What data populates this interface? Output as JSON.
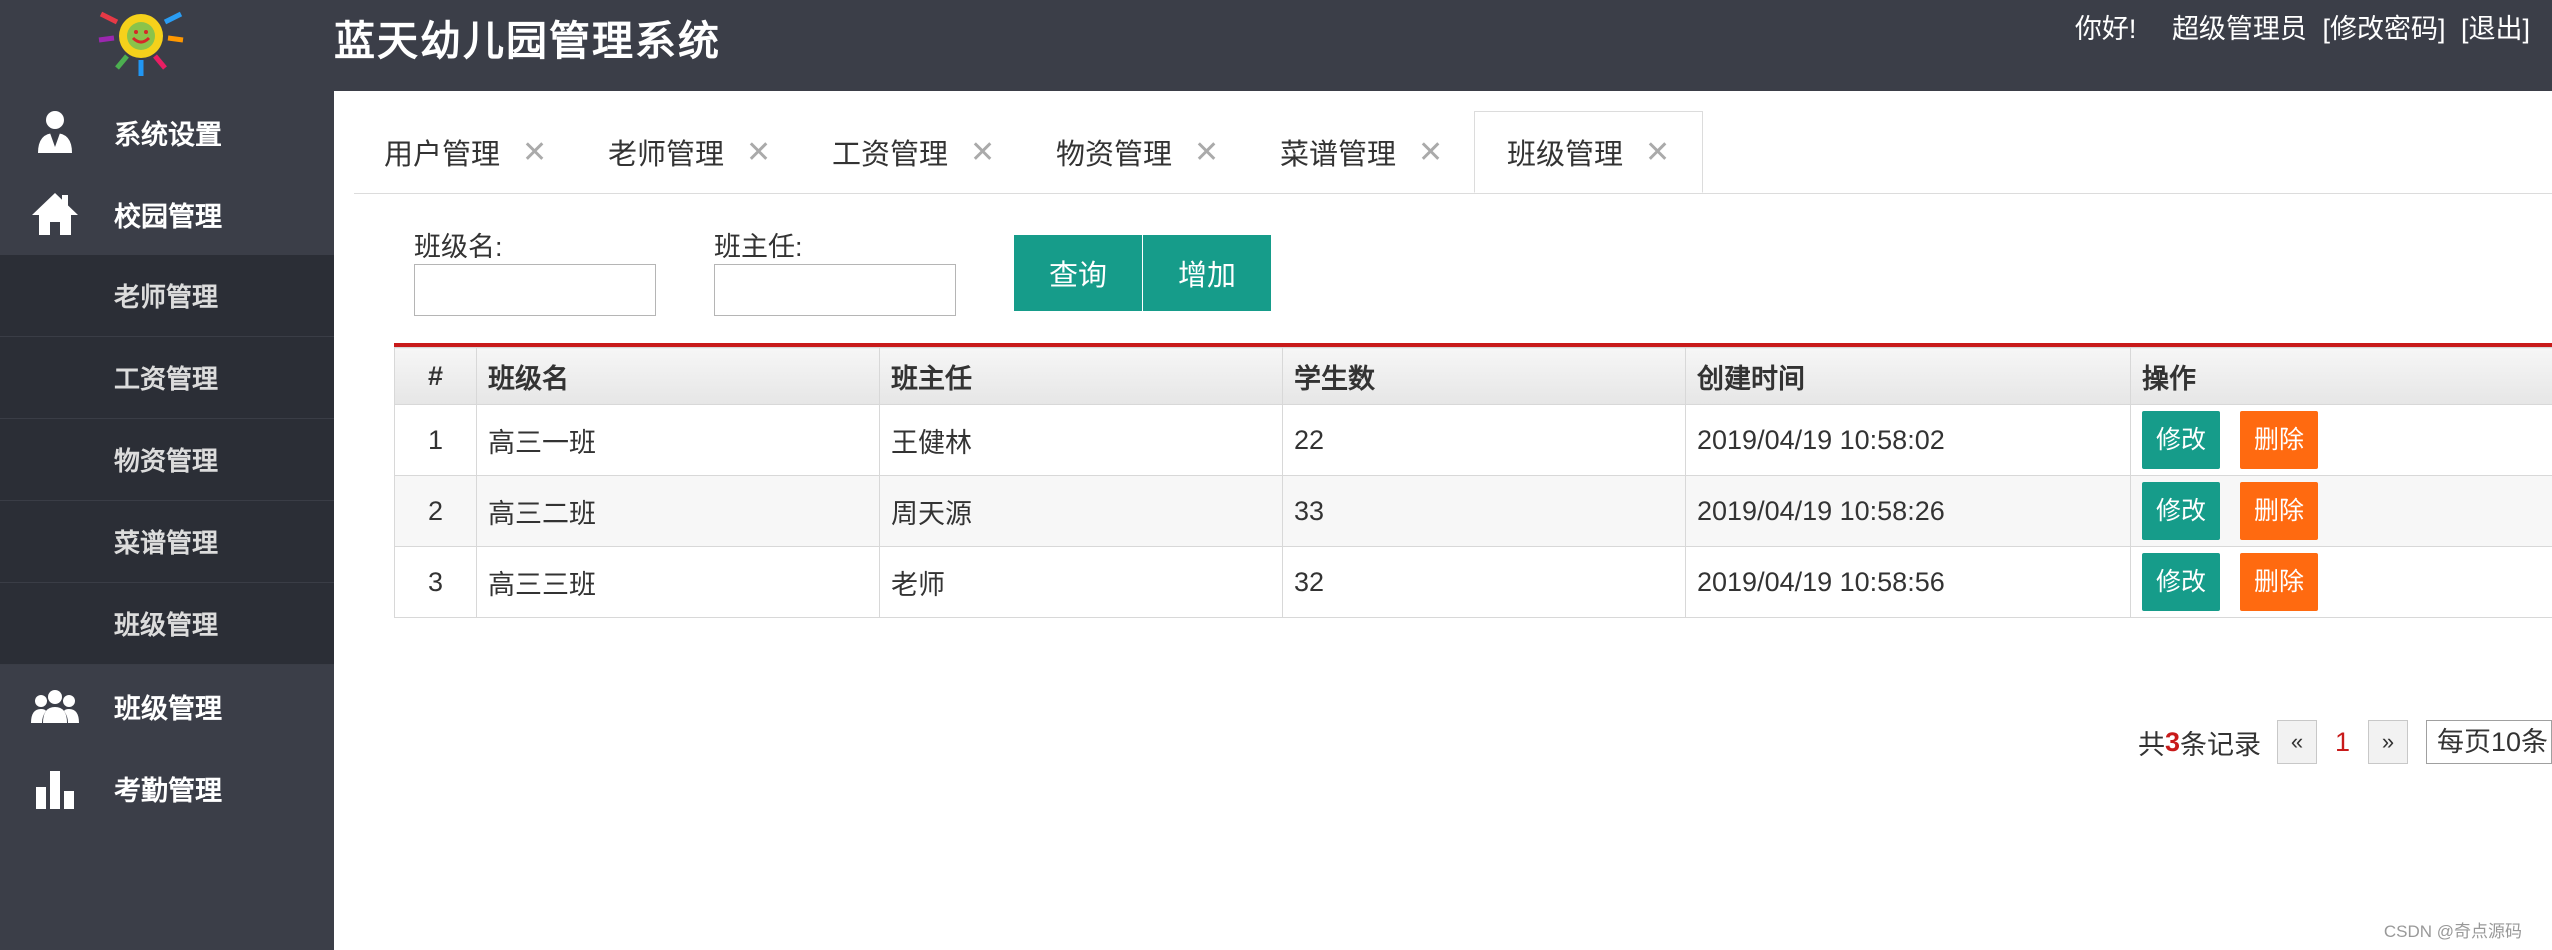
{
  "header": {
    "app_title": "蓝天幼儿园管理系统",
    "greeting": "你好!",
    "user_role": "超级管理员",
    "change_password": "[修改密码]",
    "logout": "[退出]"
  },
  "sidebar": {
    "items": [
      {
        "label": "系统设置",
        "icon": "user-settings-icon"
      },
      {
        "label": "校园管理",
        "icon": "home-icon"
      }
    ],
    "subitems": [
      {
        "label": "老师管理"
      },
      {
        "label": "工资管理"
      },
      {
        "label": "物资管理"
      },
      {
        "label": "菜谱管理"
      },
      {
        "label": "班级管理"
      }
    ],
    "items_after": [
      {
        "label": "班级管理",
        "icon": "group-icon"
      },
      {
        "label": "考勤管理",
        "icon": "bar-chart-icon"
      }
    ]
  },
  "tabs": [
    {
      "label": "用户管理",
      "active": false
    },
    {
      "label": "老师管理",
      "active": false
    },
    {
      "label": "工资管理",
      "active": false
    },
    {
      "label": "物资管理",
      "active": false
    },
    {
      "label": "菜谱管理",
      "active": false
    },
    {
      "label": "班级管理",
      "active": true
    }
  ],
  "search": {
    "class_name_label": "班级名:",
    "class_name_value": "",
    "teacher_label": "班主任:",
    "teacher_value": "",
    "query_button": "查询",
    "add_button": "增加"
  },
  "table": {
    "columns": [
      "#",
      "班级名",
      "班主任",
      "学生数",
      "创建时间",
      "操作"
    ],
    "rows": [
      {
        "idx": "1",
        "class_name": "高三一班",
        "teacher": "王健林",
        "students": "22",
        "created": "2019/04/19 10:58:02"
      },
      {
        "idx": "2",
        "class_name": "高三二班",
        "teacher": "周天源",
        "students": "33",
        "created": "2019/04/19 10:58:26"
      },
      {
        "idx": "3",
        "class_name": "高三三班",
        "teacher": "老师",
        "students": "32",
        "created": "2019/04/19 10:58:56"
      }
    ],
    "edit_label": "修改",
    "delete_label": "删除"
  },
  "pagination": {
    "prefix": "共",
    "count": "3",
    "suffix": "条记录",
    "prev": "«",
    "page": "1",
    "next": "»",
    "page_size": "每页10条"
  },
  "watermark": "CSDN @奇点源码",
  "colors": {
    "header_bg": "#3b3e48",
    "submenu_bg": "#2b2e36",
    "accent_green": "#169c8a",
    "delete_orange": "#ff6a10",
    "accent_red": "#c81a1a"
  }
}
